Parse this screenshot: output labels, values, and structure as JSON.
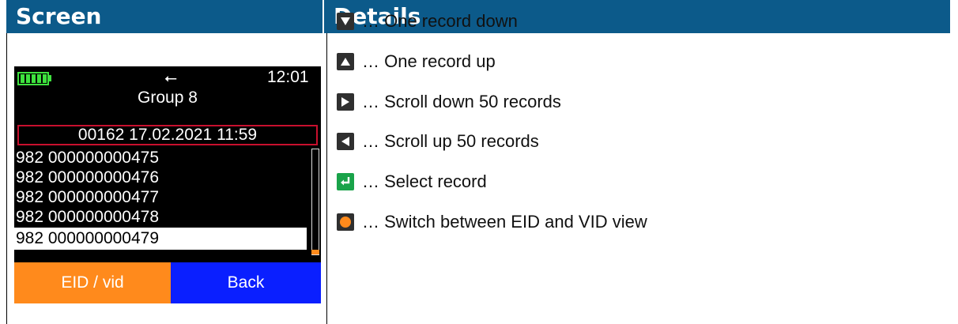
{
  "table": {
    "headers": {
      "screen": "Screen",
      "details": "Details"
    }
  },
  "device": {
    "time": "12:01",
    "group": "Group 8",
    "highlighted_record": "00162 17.02.2021 11:59",
    "records": [
      "982 000000000475",
      "982 000000000476",
      "982 000000000477",
      "982 000000000478",
      "982 000000000479"
    ],
    "selected_index": 4,
    "buttons": {
      "left": "EID / vid",
      "right": "Back"
    },
    "colors": {
      "battery": "#3ee23e",
      "highlight_border": "#c8102e",
      "left_button": "#ff8a1c",
      "right_button": "#0a1fff"
    }
  },
  "details": [
    {
      "icon": "arrow-down-key-icon",
      "text": "… One record down"
    },
    {
      "icon": "arrow-up-key-icon",
      "text": "… One record up"
    },
    {
      "icon": "arrow-right-key-icon",
      "text": "… Scroll down 50 records"
    },
    {
      "icon": "arrow-left-key-icon",
      "text": "… Scroll up 50 records"
    },
    {
      "icon": "enter-key-icon",
      "text": "… Select record"
    },
    {
      "icon": "orange-button-icon",
      "text": "… Switch between EID and VID view"
    }
  ]
}
